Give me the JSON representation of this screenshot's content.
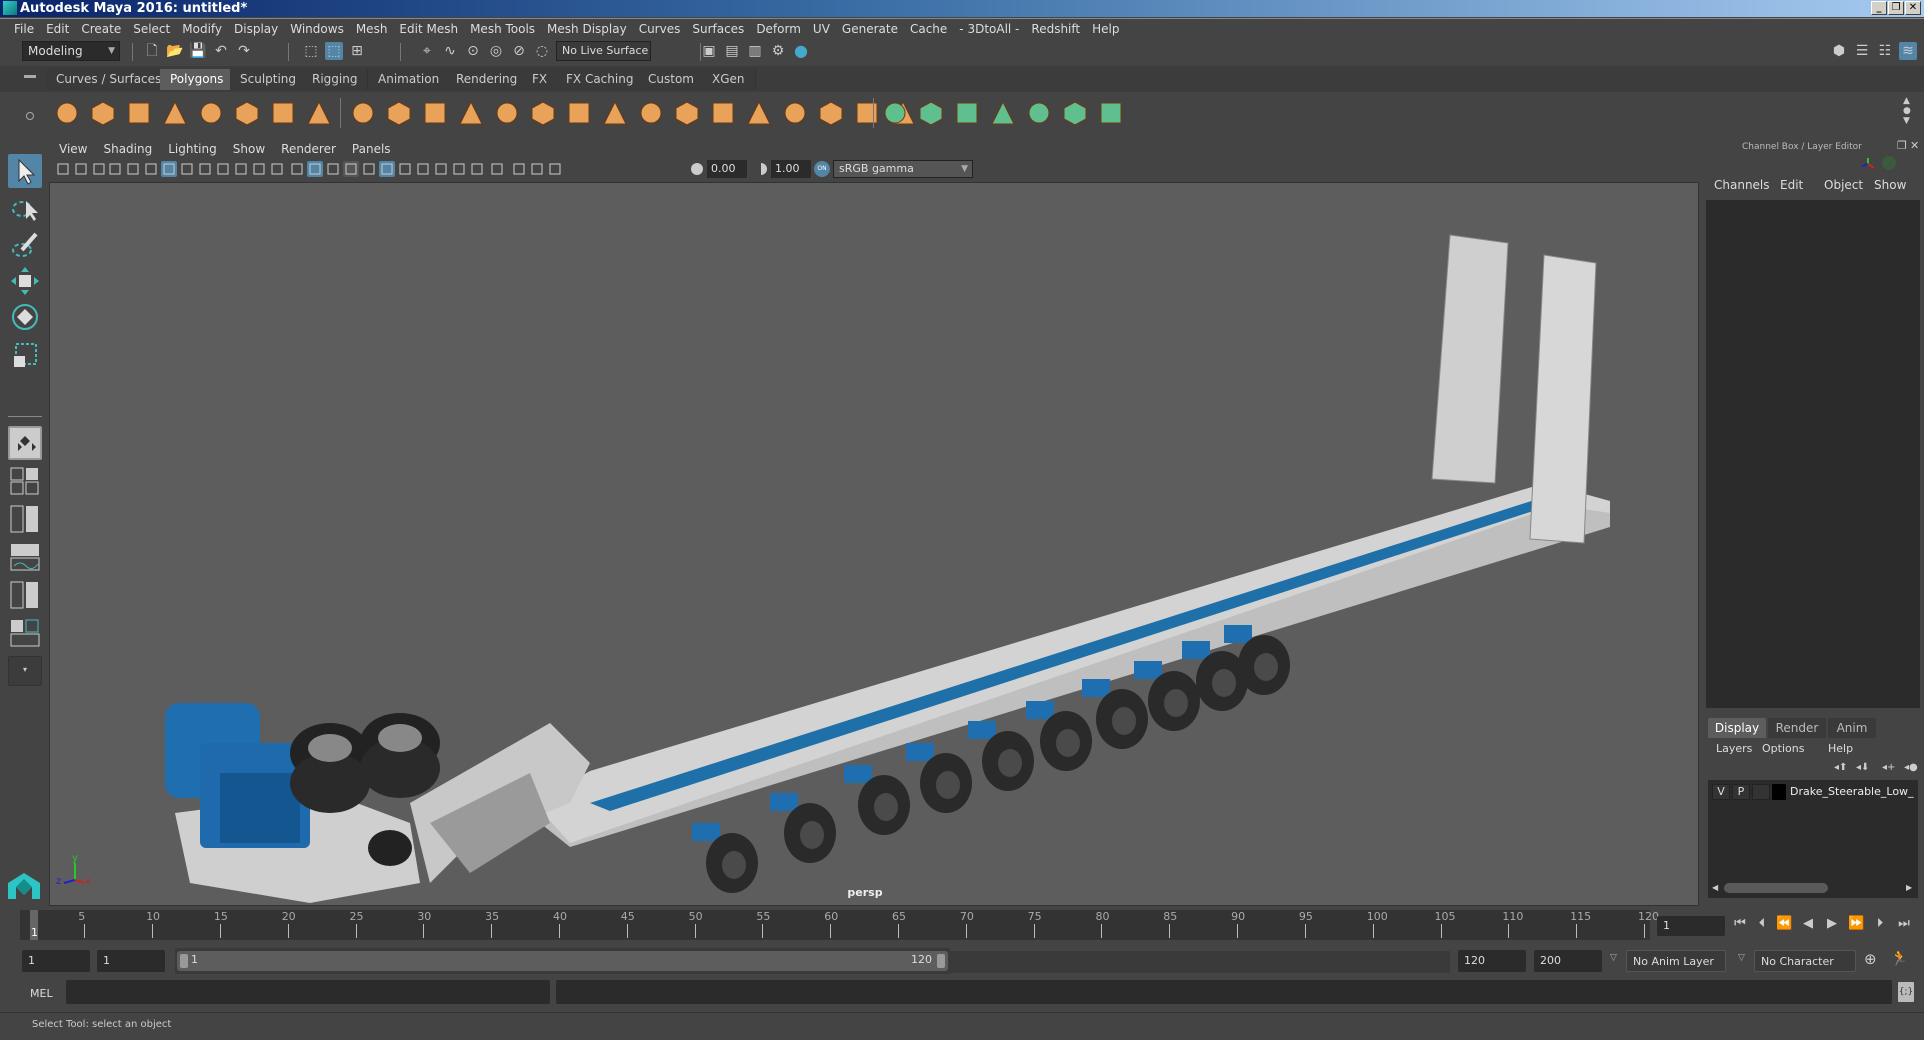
{
  "window": {
    "title": "Autodesk Maya 2016: untitled*",
    "buttons": {
      "minimize": "_",
      "restore": "❐",
      "close": "✕"
    }
  },
  "menubar": {
    "items": [
      "File",
      "Edit",
      "Create",
      "Select",
      "Modify",
      "Display",
      "Windows",
      "Mesh",
      "Edit Mesh",
      "Mesh Tools",
      "Mesh Display",
      "Curves",
      "Surfaces",
      "Deform",
      "UV",
      "Generate",
      "Cache",
      "- 3DtoAll -",
      "Redshift",
      "Help"
    ]
  },
  "statusline": {
    "menuset": "Modeling",
    "live_surface": "No Live Surface"
  },
  "shelf": {
    "tabs": [
      "Curves / Surfaces",
      "Polygons",
      "Sculpting",
      "Rigging",
      "Animation",
      "Rendering",
      "FX",
      "FX Caching",
      "Custom",
      "XGen"
    ],
    "active_tab": "Polygons",
    "icons": [
      "poly-sphere-icon",
      "poly-cube-icon",
      "poly-cylinder-icon",
      "poly-cone-icon",
      "poly-plane-icon",
      "poly-torus-icon",
      "poly-pyramid-icon",
      "poly-pipe-icon",
      "combine-icon",
      "separate-icon",
      "smooth-icon",
      "extract-icon",
      "boolean-icon",
      "bevel-icon",
      "bridge-icon",
      "multi-cut-icon",
      "extrude-icon",
      "append-icon",
      "merge-icon",
      "fill-hole-icon",
      "insert-edge-loop-icon",
      "offset-edge-loop-icon",
      "target-weld-icon",
      "quad-draw-icon",
      "planar-uv-icon",
      "cylindrical-uv-icon",
      "spherical-uv-icon",
      "automatic-uv-icon",
      "unfold-uv-icon",
      "uv-editor-icon",
      "sew-uv-icon"
    ]
  },
  "viewport": {
    "menus": [
      "View",
      "Shading",
      "Lighting",
      "Show",
      "Renderer",
      "Panels"
    ],
    "exposure": "0.00",
    "gamma": "1.00",
    "color_management": "sRGB gamma",
    "camera_label": "persp",
    "axis": {
      "x": "x",
      "y": "y",
      "z": "z"
    }
  },
  "channelbox": {
    "title": "Channel Box / Layer Editor",
    "menus": [
      "Channels",
      "Edit",
      "Object",
      "Show"
    ]
  },
  "layereditor": {
    "tabs": [
      "Display",
      "Render",
      "Anim"
    ],
    "active_tab": "Display",
    "menus": [
      "Layers",
      "Options",
      "Help"
    ],
    "layers": [
      {
        "visible": "V",
        "playback": "P",
        "name": "Drake_Steerable_Low_"
      }
    ]
  },
  "timeline": {
    "ticks": [
      "5",
      "10",
      "15",
      "20",
      "25",
      "30",
      "35",
      "40",
      "45",
      "50",
      "55",
      "60",
      "65",
      "70",
      "75",
      "80",
      "85",
      "90",
      "95",
      "100",
      "105",
      "110",
      "115",
      "120"
    ],
    "start_marker": "1",
    "current_frame": "1"
  },
  "range": {
    "start_time": "1",
    "playback_start": "1",
    "slider_start": "1",
    "slider_end": "120",
    "playback_end": "120",
    "end_time": "200",
    "anim_layer": "No Anim Layer",
    "character_set": "No Character Set"
  },
  "commandline": {
    "mode": "MEL",
    "input": "",
    "output": ""
  },
  "helpline": {
    "text": "Select Tool: select an object"
  },
  "colors": {
    "accent": "#5285a6",
    "shelf_icon": "#e8a25a",
    "uv_icon": "#5fbf8f",
    "viewport_bg": "#5d5d5d"
  }
}
